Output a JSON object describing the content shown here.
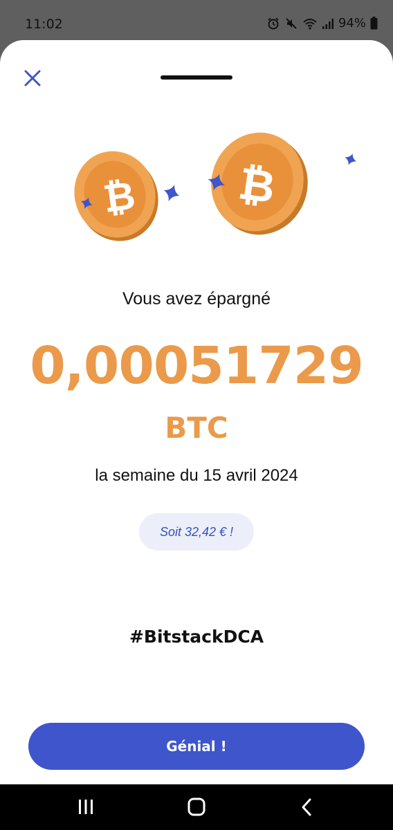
{
  "status": {
    "time": "11:02",
    "battery": "94%"
  },
  "sheet": {
    "headline": "Vous avez épargné",
    "amount": "0,00051729",
    "unit": "BTC",
    "period": "la semaine du 15 avril 2024",
    "conversion": "Soit 32,42 € !",
    "hashtag": "#BitstackDCA",
    "cta_label": "Génial !"
  },
  "icons": {
    "close": "close-icon",
    "coin": "bitcoin-coin-icon",
    "sparkle": "sparkle-icon",
    "nav_recents": "recents-icon",
    "nav_home": "home-icon",
    "nav_back": "back-icon"
  },
  "colors": {
    "accent": "#3f55cb",
    "bitcoin_orange": "#ea9a4a",
    "pill_bg": "#eceff9"
  }
}
